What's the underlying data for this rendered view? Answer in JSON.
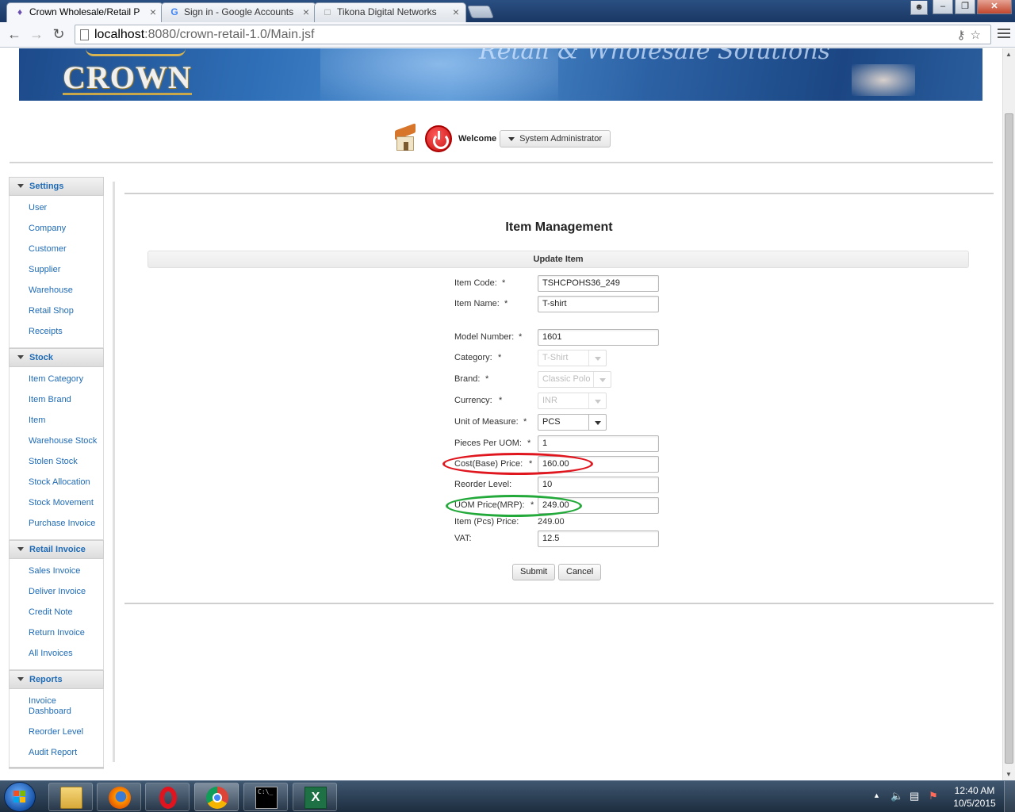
{
  "browser": {
    "tabs": [
      {
        "title": "Crown Wholesale/Retail P",
        "icon": "crown-favicon"
      },
      {
        "title": "Sign in - Google Accounts",
        "icon": "google-favicon"
      },
      {
        "title": "Tikona Digital Networks",
        "icon": "page-icon"
      }
    ],
    "url_host": "localhost",
    "url_rest": ":8080/crown-retail-1.0/Main.jsf"
  },
  "header": {
    "logo": "CROWN",
    "tagline": "Retail & Wholesale Solutions",
    "welcome": "Welcome",
    "user": "System Administrator"
  },
  "sidebar": {
    "sections": [
      {
        "title": "Settings",
        "items": [
          "User",
          "Company",
          "Customer",
          "Supplier",
          "Warehouse",
          "Retail Shop",
          "Receipts"
        ]
      },
      {
        "title": "Stock",
        "items": [
          "Item Category",
          "Item Brand",
          "Item",
          "Warehouse Stock",
          "Stolen Stock",
          "Stock Allocation",
          "Stock Movement",
          "Purchase Invoice"
        ]
      },
      {
        "title": "Retail Invoice",
        "items": [
          "Sales Invoice",
          "Deliver Invoice",
          "Credit Note",
          "Return Invoice",
          "All Invoices"
        ]
      },
      {
        "title": "Reports",
        "items": [
          "Invoice Dashboard",
          "Reorder Level",
          "Audit Report"
        ]
      }
    ]
  },
  "main": {
    "title": "Item Management",
    "panel_title": "Update Item",
    "fields": {
      "item_code": {
        "label": "Item Code:",
        "req": "*",
        "value": "TSHCPOHS36_249"
      },
      "item_name": {
        "label": "Item Name:",
        "req": "*",
        "value": "T-shirt"
      },
      "model_number": {
        "label": "Model Number:",
        "req": "*",
        "value": "1601"
      },
      "category": {
        "label": "Category:",
        "req": "*",
        "value": "T-Shirt"
      },
      "brand": {
        "label": "Brand:",
        "req": "*",
        "value": "Classic Polo"
      },
      "currency": {
        "label": "Currency:",
        "req": "*",
        "value": "INR"
      },
      "uom": {
        "label": "Unit of Measure:",
        "req": "*",
        "value": "PCS"
      },
      "pieces_per_uom": {
        "label": "Pieces Per UOM:",
        "req": "*",
        "value": "1"
      },
      "cost_price": {
        "label": "Cost(Base) Price:",
        "req": "*",
        "value": "160.00"
      },
      "reorder_level": {
        "label": "Reorder Level:",
        "value": "10"
      },
      "uom_price": {
        "label": "UOM Price(MRP):",
        "req": "*",
        "value": "249.00"
      },
      "item_pcs_price": {
        "label": "Item (Pcs) Price:",
        "value": "249.00"
      },
      "vat": {
        "label": "VAT:",
        "value": "12.5"
      }
    },
    "submit_label": "Submit",
    "cancel_label": "Cancel"
  },
  "annotations": {
    "cost_circle_color": "#e0161f",
    "mrp_circle_color": "#22a93a"
  },
  "taskbar": {
    "apps": [
      "file-explorer-icon",
      "firefox-icon",
      "opera-icon",
      "chrome-icon",
      "cmd-icon",
      "excel-icon"
    ],
    "time": "12:40 AM",
    "date": "10/5/2015"
  }
}
